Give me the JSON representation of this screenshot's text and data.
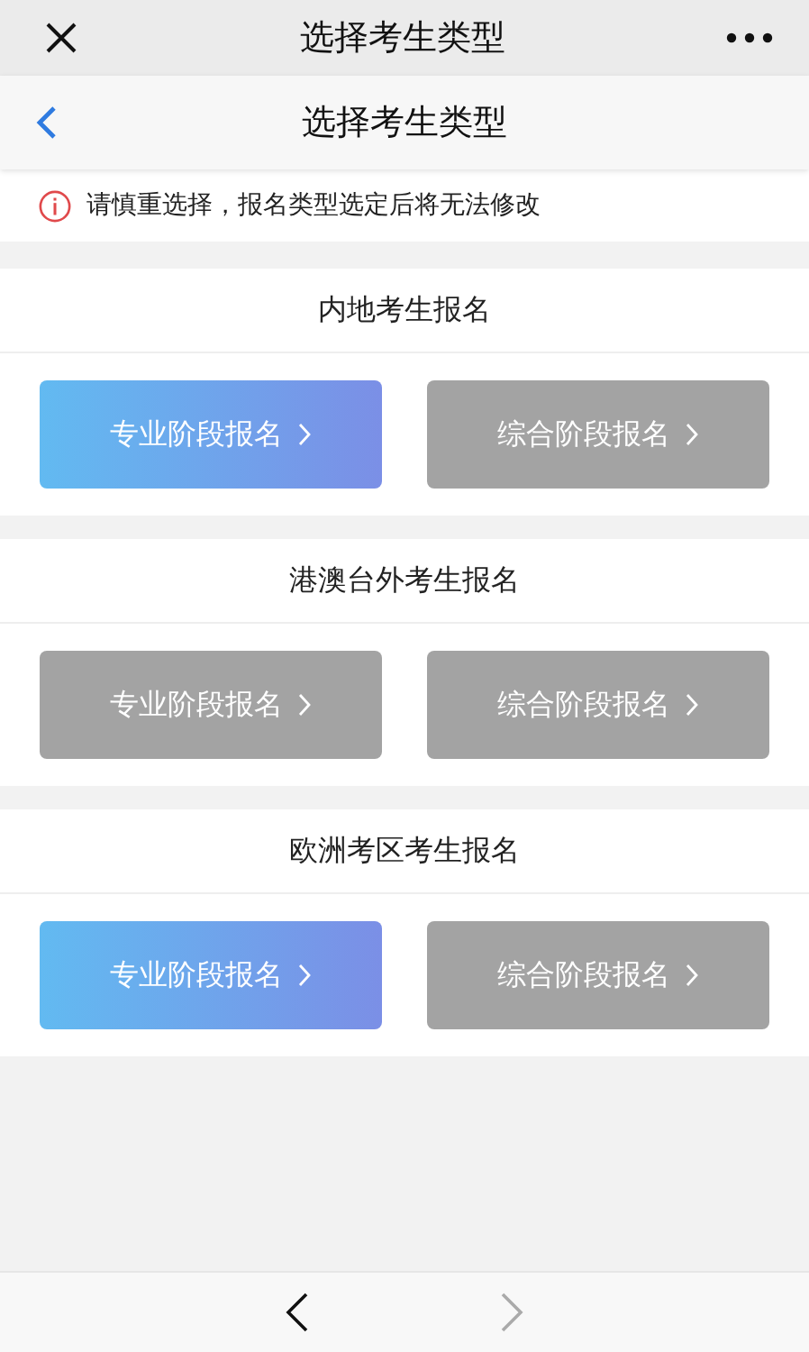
{
  "top_bar": {
    "title": "选择考生类型"
  },
  "nav_bar": {
    "title": "选择考生类型"
  },
  "notice": "请慎重选择，报名类型选定后将无法修改",
  "sections": [
    {
      "title": "内地考生报名",
      "buttons": [
        {
          "label": "专业阶段报名",
          "disabled": false
        },
        {
          "label": "综合阶段报名",
          "disabled": true
        }
      ]
    },
    {
      "title": "港澳台外考生报名",
      "buttons": [
        {
          "label": "专业阶段报名",
          "disabled": true
        },
        {
          "label": "综合阶段报名",
          "disabled": true
        }
      ]
    },
    {
      "title": "欧洲考区考生报名",
      "buttons": [
        {
          "label": "专业阶段报名",
          "disabled": false
        },
        {
          "label": "综合阶段报名",
          "disabled": true
        }
      ]
    }
  ],
  "browser_toolbar": {
    "back_disabled": false,
    "forward_disabled": true
  }
}
